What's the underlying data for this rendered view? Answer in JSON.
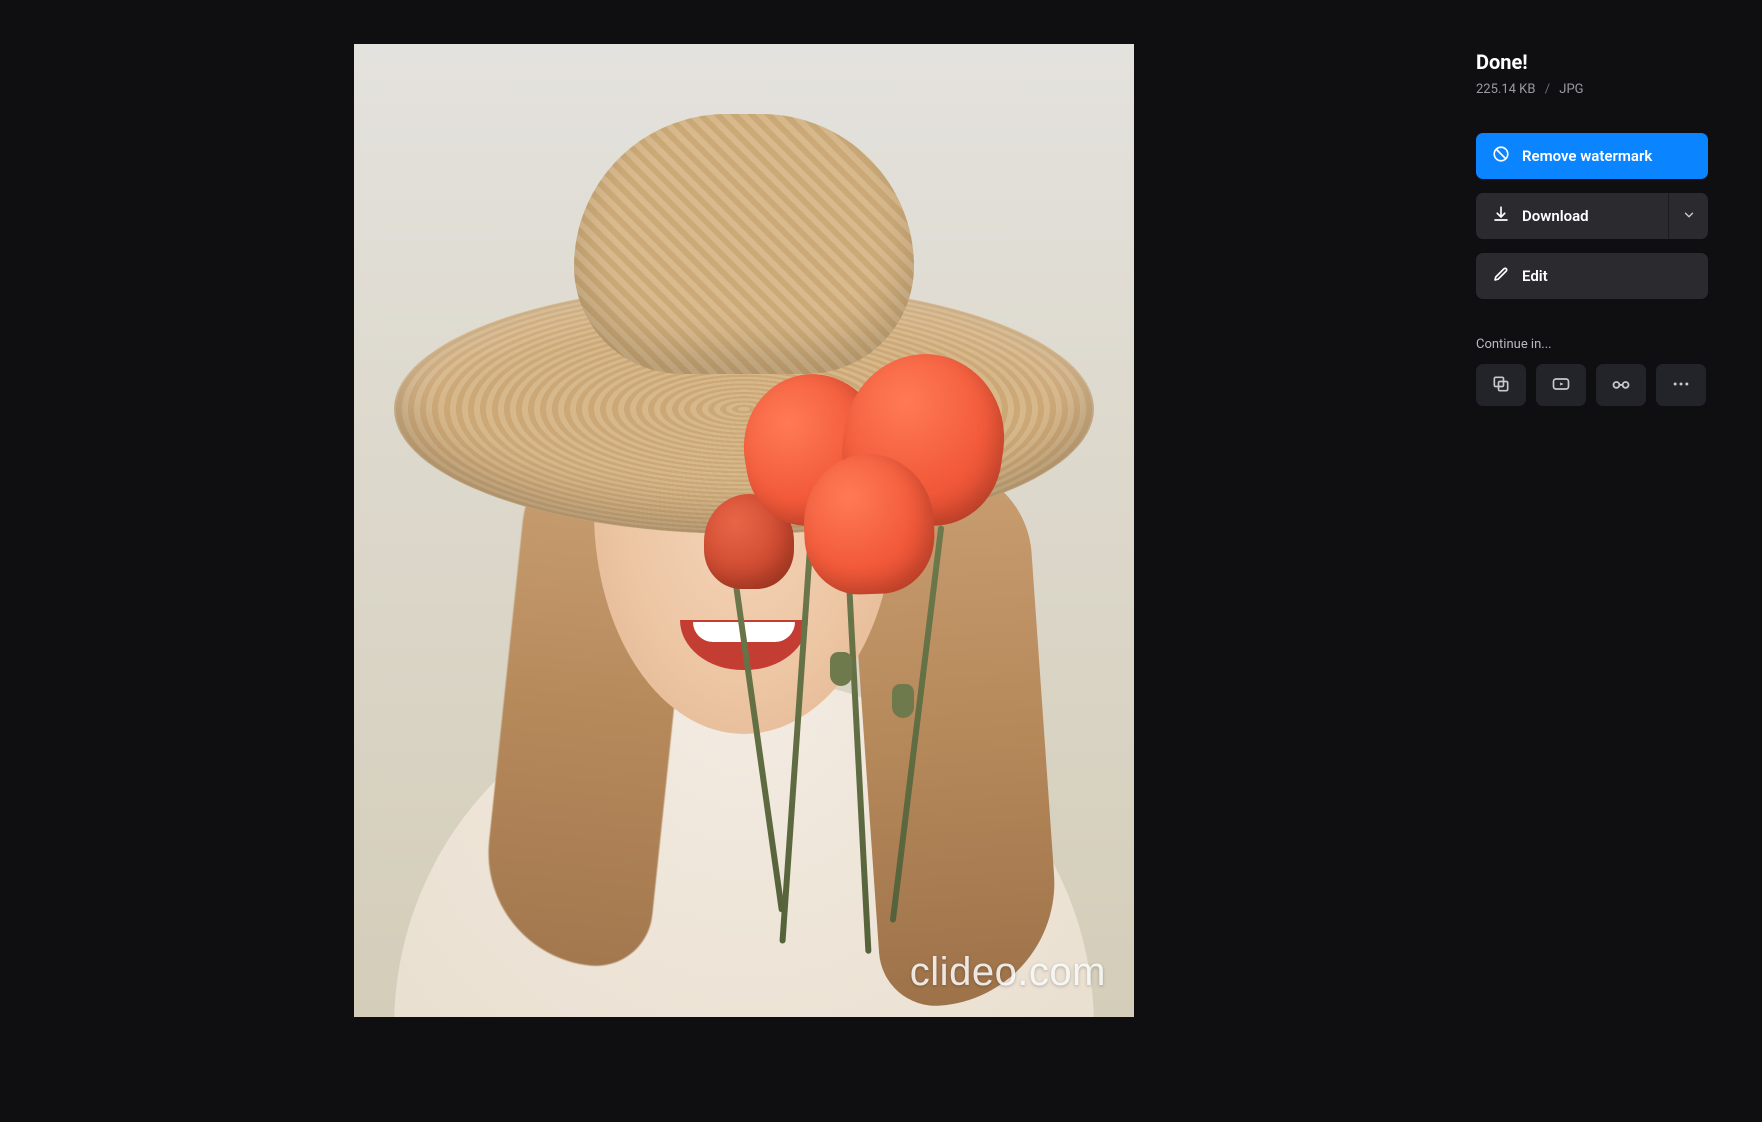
{
  "status": {
    "title": "Done!",
    "file_size": "225.14 KB",
    "file_format": "JPG"
  },
  "actions": {
    "remove_watermark": "Remove watermark",
    "download": "Download",
    "edit": "Edit"
  },
  "continue": {
    "label": "Continue in...",
    "tools": [
      {
        "name": "merge",
        "icon": "overlap-squares-icon"
      },
      {
        "name": "video",
        "icon": "video-icon"
      },
      {
        "name": "meme",
        "icon": "glasses-icon"
      },
      {
        "name": "more",
        "icon": "more-icon"
      }
    ]
  },
  "preview": {
    "watermark_text": "clideo.com",
    "description": "Smiling woman wearing a wide-brim straw hat holding orange poppy flowers"
  },
  "colors": {
    "primary": "#0a84ff",
    "surface": "#2a2a2f",
    "bg": "#0f0f12"
  }
}
